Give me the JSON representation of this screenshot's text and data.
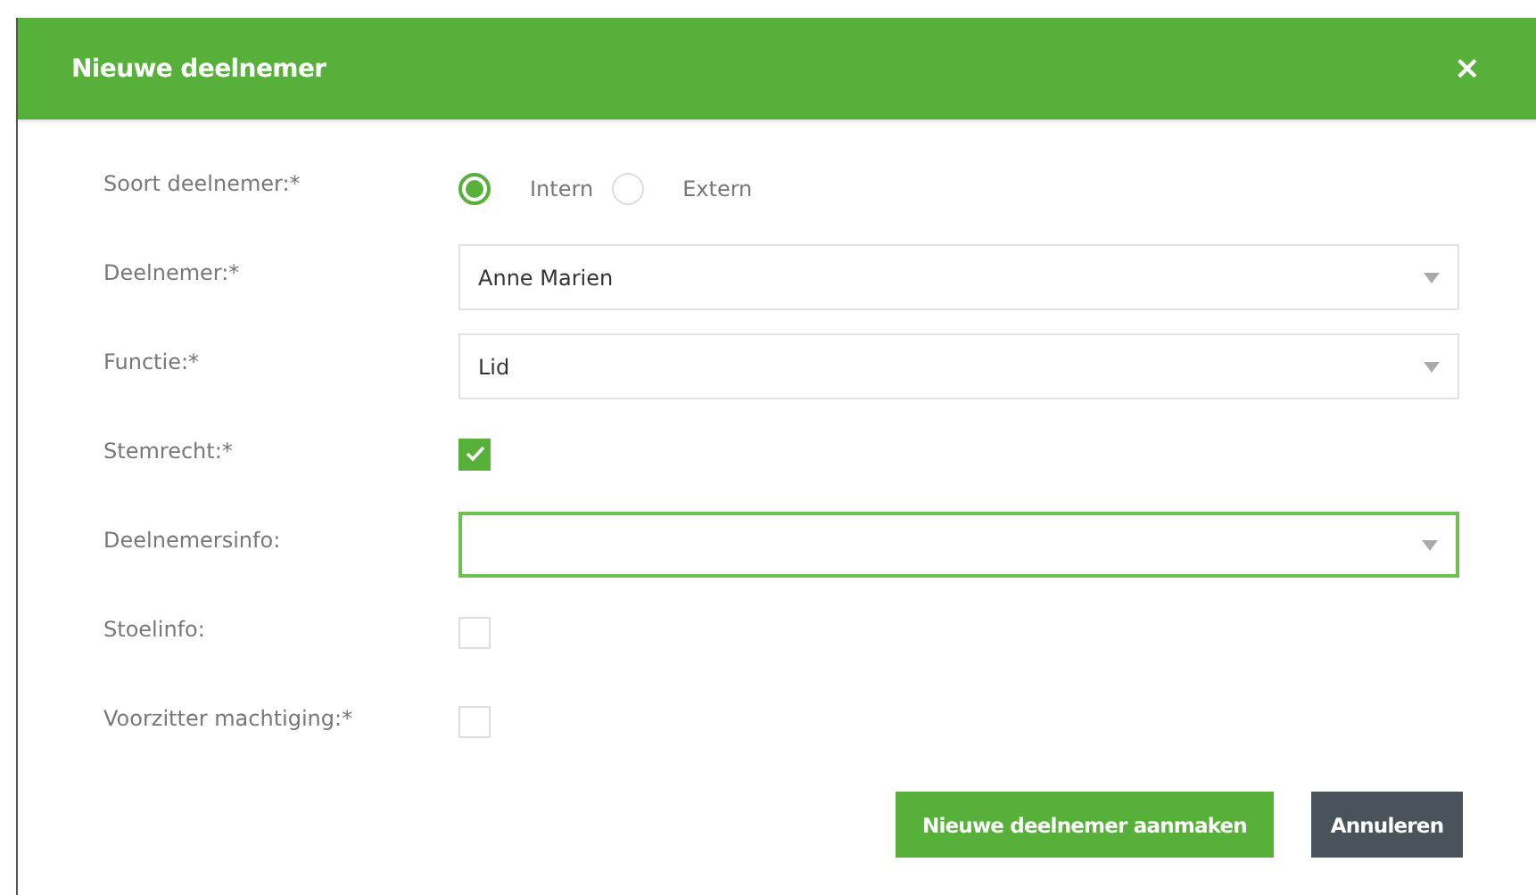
{
  "dialog": {
    "title": "Nieuwe deelnemer",
    "close": "×",
    "fields": [
      {
        "kind": "radio",
        "label": "Soort deelnemer:*",
        "options": [
          {
            "label": "Intern",
            "selected": true
          },
          {
            "label": "Extern",
            "selected": false
          }
        ]
      },
      {
        "kind": "select",
        "label": "Deelnemer:*",
        "value": "Anne Marien",
        "focused": false
      },
      {
        "kind": "select",
        "label": "Functie:*",
        "value": "Lid",
        "focused": false
      },
      {
        "kind": "checkbox",
        "label": "Stemrecht:*",
        "checked": true
      },
      {
        "kind": "select",
        "label": "Deelnemersinfo:",
        "focused": true
      },
      {
        "kind": "checkbox",
        "label": "Stoelinfo:",
        "checked": false
      },
      {
        "kind": "checkbox",
        "label": "Voorzitter machtiging:*",
        "checked": false
      }
    ],
    "buttons": [
      {
        "kind": "primary",
        "label": "Nieuwe deelnemer aanmaken"
      },
      {
        "kind": "secondary",
        "label": "Annuleren"
      }
    ]
  }
}
